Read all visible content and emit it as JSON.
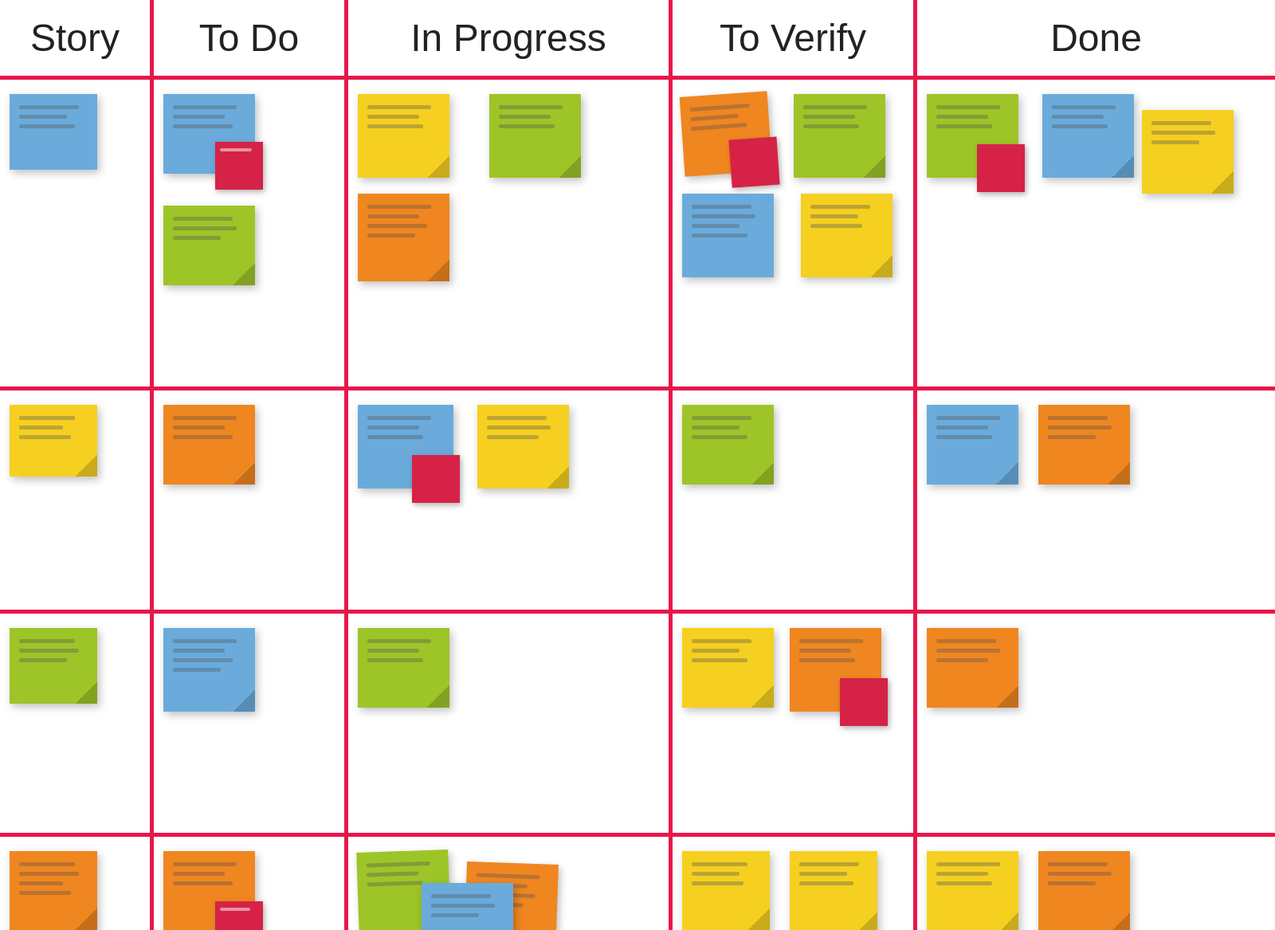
{
  "headers": [
    "Story",
    "To Do",
    "In Progress",
    "To Verify",
    "Done"
  ],
  "colors": {
    "border": "#e8174a",
    "blue": "#6aabdc",
    "yellow": "#f5d020",
    "green": "#9dc528",
    "orange": "#f08620",
    "red": "#d62246"
  }
}
